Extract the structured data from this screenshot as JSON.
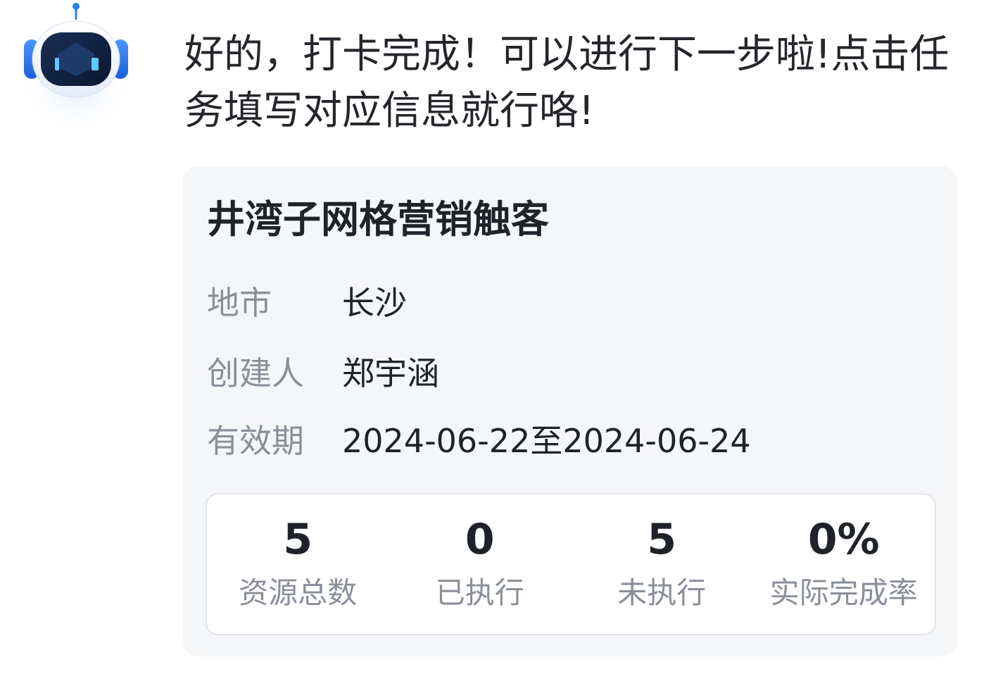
{
  "assistant": {
    "avatar_icon": "robot-icon",
    "message": "好的，打卡完成！可以进行下一步啦!点击任务填写对应信息就行咯!"
  },
  "task_card": {
    "title": "井湾子网格营销触客",
    "fields": {
      "city": {
        "label": "地市",
        "value": "长沙"
      },
      "creator": {
        "label": "创建人",
        "value": "郑宇涵"
      },
      "period": {
        "label": "有效期",
        "value": "2024-06-22至2024-06-24"
      }
    },
    "stats": [
      {
        "value": "5",
        "label": "资源总数"
      },
      {
        "value": "0",
        "label": "已执行"
      },
      {
        "value": "5",
        "label": "未执行"
      },
      {
        "value": "0%",
        "label": "实际完成率"
      }
    ]
  },
  "colors": {
    "card_background": "#f5f6f8",
    "label_gray": "#8a8f99",
    "text_dark": "#1f2329",
    "robot_blue": "#2f7bf0"
  }
}
